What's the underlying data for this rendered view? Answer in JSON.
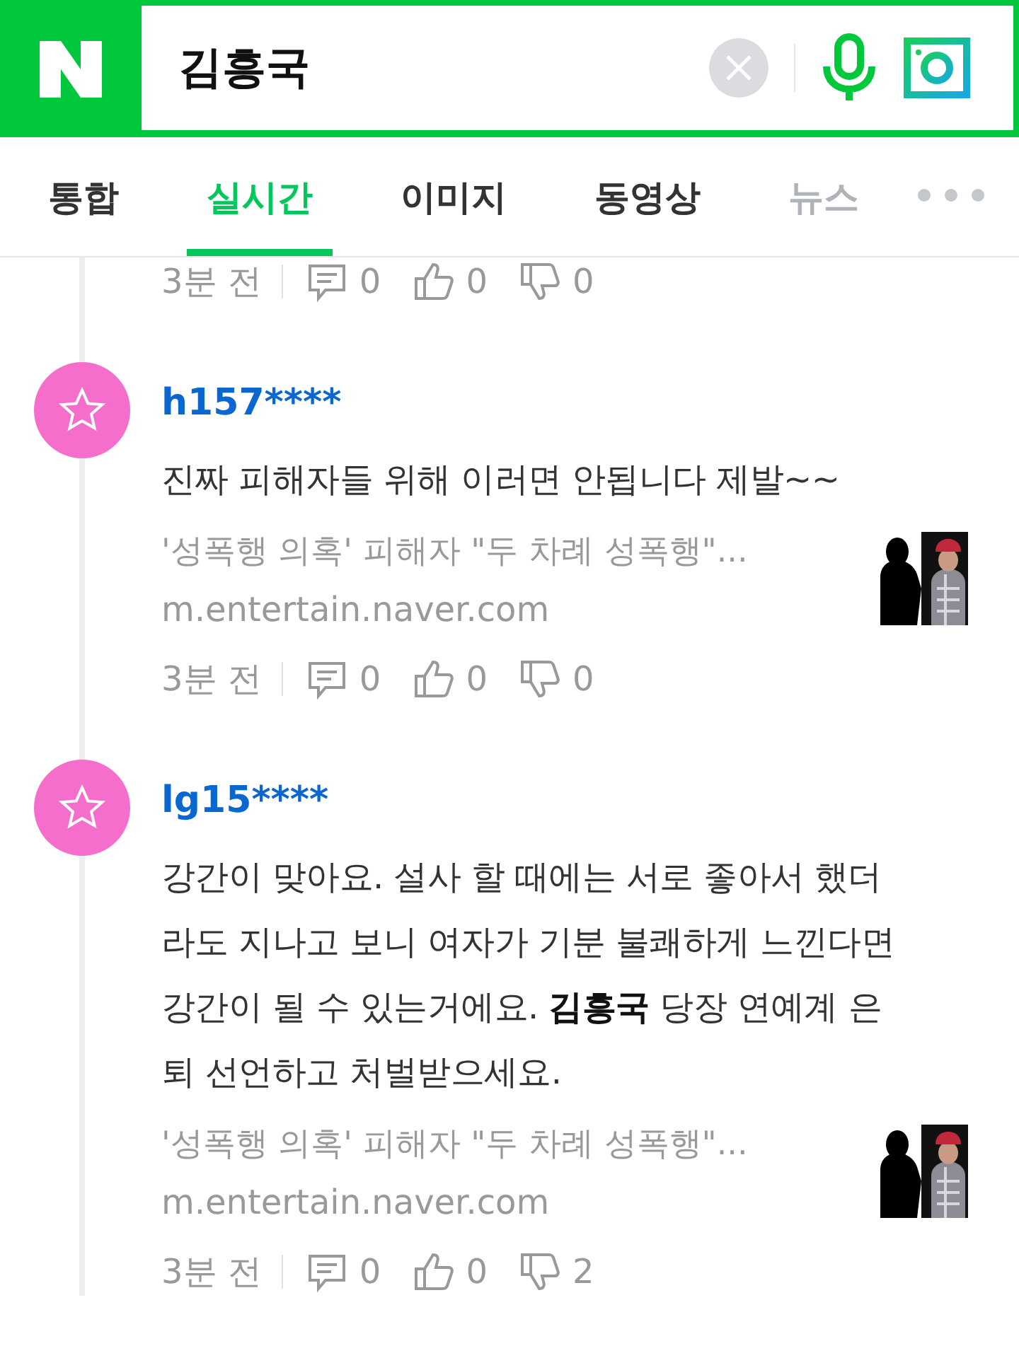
{
  "search": {
    "value": "김흥국"
  },
  "tabs": [
    {
      "label": "통합",
      "selected": false
    },
    {
      "label": "실시간",
      "selected": true
    },
    {
      "label": "이미지",
      "selected": false
    },
    {
      "label": "동영상",
      "selected": false
    },
    {
      "label": "뉴스",
      "selected": false
    }
  ],
  "top_meta": {
    "time": "3분 전",
    "replies": "0",
    "likes": "0",
    "dislikes": "0"
  },
  "comments": [
    {
      "user": "h157****",
      "text": "진짜 피해자들 위해 이러면 안됩니다 제발~~",
      "link_title": "'성폭행 의혹' 피해자 \"두 차례 성폭행\"...",
      "link_domain": "m.entertain.naver.com",
      "time": "3분 전",
      "replies": "0",
      "likes": "0",
      "dislikes": "0"
    },
    {
      "user": "lg15****",
      "text": "강간이 맞아요. 설사 할 때에는 서로 좋아서 했더라도 지나고 보니 여자가 기분 불쾌하게 느낀다면 강간이 될 수 있는거에요. **김흥국** 당장 연예계 은퇴 선언하고 처벌받으세요.",
      "link_title": "'성폭행 의혹' 피해자 \"두 차례 성폭행\"...",
      "link_domain": "m.entertain.naver.com",
      "time": "3분 전",
      "replies": "0",
      "likes": "0",
      "dislikes": "2"
    }
  ]
}
